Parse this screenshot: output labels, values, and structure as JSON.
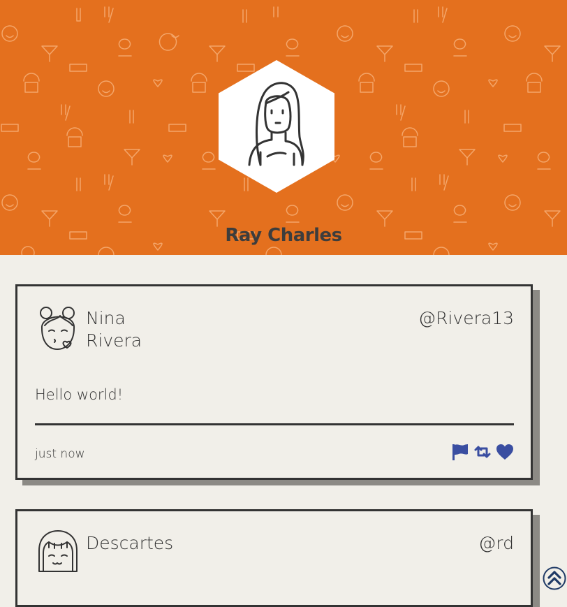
{
  "profile": {
    "name": "Ray Charles",
    "banner_color": "#e4701e"
  },
  "posts": [
    {
      "author_first": "Nina",
      "author_last": "Rivera",
      "handle": "@Rivera13",
      "text": "Hello world!",
      "time": "just now",
      "actions": [
        "flag-icon",
        "retweet-icon",
        "heart-icon"
      ]
    },
    {
      "author_first": "Descartes",
      "author_last": "",
      "handle": "@rd"
    }
  ],
  "accent_color": "#3a4ea1",
  "scroll_top_icon": "double-chevron-up-icon"
}
